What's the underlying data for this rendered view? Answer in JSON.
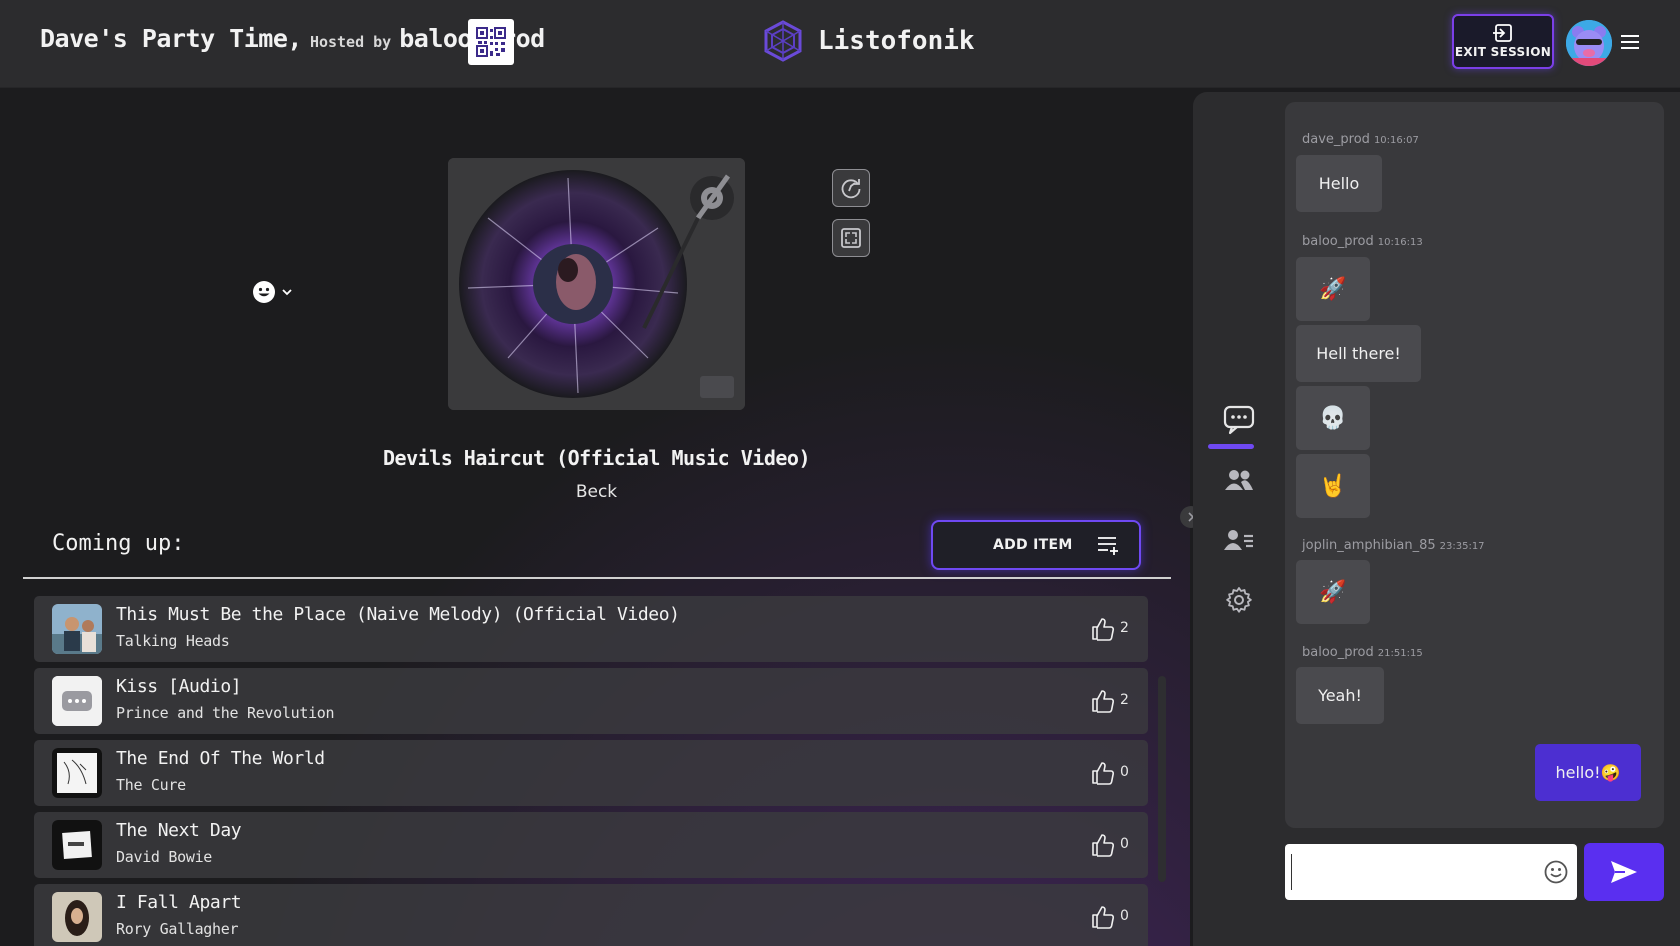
{
  "header": {
    "party_name": "Dave's Party Time,",
    "hosted_by": "Hosted by",
    "host_name": "baloo_prod",
    "brand": "Listofonik",
    "exit_label": "EXIT SESSION"
  },
  "now_playing": {
    "title": "Devils Haircut (Official Music Video)",
    "artist": "Beck"
  },
  "queue": {
    "heading": "Coming up:",
    "add_item_label": "ADD ITEM",
    "items": [
      {
        "title": "This Must Be the Place (Naive Melody) (Official Video)",
        "artist": "Talking Heads",
        "likes": "2"
      },
      {
        "title": "Kiss [Audio]",
        "artist": "Prince and the Revolution",
        "likes": "2"
      },
      {
        "title": "The End Of The World",
        "artist": "The Cure",
        "likes": "0"
      },
      {
        "title": "The Next Day",
        "artist": "David Bowie",
        "likes": "0"
      },
      {
        "title": "I Fall Apart",
        "artist": "Rory Gallagher",
        "likes": "0"
      }
    ]
  },
  "chat": {
    "messages": [
      {
        "user": "dave_prod",
        "time": "10:16:07",
        "bubbles": [
          "Hello"
        ]
      },
      {
        "user": "baloo_prod",
        "time": "10:16:13",
        "bubbles": [
          "🚀",
          "Hell there!",
          "💀",
          "🤘"
        ]
      },
      {
        "user": "joplin_amphibian_85",
        "time": "23:35:17",
        "bubbles": [
          "🚀"
        ]
      },
      {
        "user": "baloo_prod",
        "time": "21:51:15",
        "bubbles": [
          "Yeah!"
        ]
      }
    ],
    "my_message": "hello!🤪",
    "input_value": ""
  },
  "colors": {
    "accent": "#6f49f2",
    "background": "#1c1c1e",
    "panel": "#2c2c2e"
  }
}
